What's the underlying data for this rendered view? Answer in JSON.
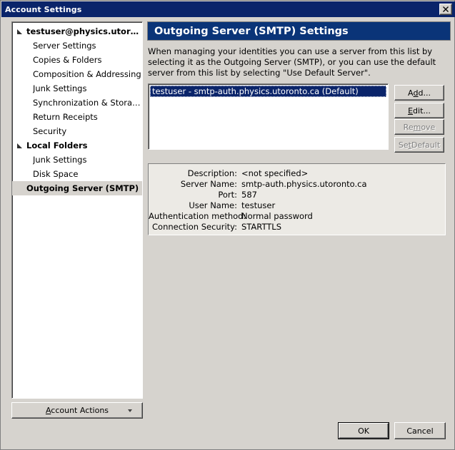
{
  "window": {
    "title": "Account Settings",
    "close_icon": "close-icon",
    "close_label": "✕"
  },
  "sidebar": {
    "items": [
      {
        "label": "testuser@physics.utoron...",
        "level": 0,
        "expanded": true,
        "selected": false
      },
      {
        "label": "Server Settings",
        "level": 1,
        "expanded": false,
        "selected": false
      },
      {
        "label": "Copies & Folders",
        "level": 1,
        "expanded": false,
        "selected": false
      },
      {
        "label": "Composition & Addressing",
        "level": 1,
        "expanded": false,
        "selected": false
      },
      {
        "label": "Junk Settings",
        "level": 1,
        "expanded": false,
        "selected": false
      },
      {
        "label": "Synchronization & Storage",
        "level": 1,
        "expanded": false,
        "selected": false
      },
      {
        "label": "Return Receipts",
        "level": 1,
        "expanded": false,
        "selected": false
      },
      {
        "label": "Security",
        "level": 1,
        "expanded": false,
        "selected": false
      },
      {
        "label": "Local Folders",
        "level": 0,
        "expanded": true,
        "selected": false
      },
      {
        "label": "Junk Settings",
        "level": 1,
        "expanded": false,
        "selected": false
      },
      {
        "label": "Disk Space",
        "level": 1,
        "expanded": false,
        "selected": false
      },
      {
        "label": "Outgoing Server (SMTP)",
        "level": 0,
        "expanded": false,
        "selected": true
      }
    ],
    "account_actions": {
      "label": "Account Actions",
      "accel": "A",
      "arrow_icon": "chevron-down-icon"
    }
  },
  "panel": {
    "header": "Outgoing Server (SMTP) Settings",
    "description": "When managing your identities you can use a server from this list by selecting it as the Outgoing Server (SMTP), or you can use the default server from this list by selecting \"Use Default Server\".",
    "server_list": {
      "items": [
        {
          "label": "testuser - smtp-auth.physics.utoronto.ca (Default)",
          "selected": true
        }
      ]
    },
    "buttons": [
      {
        "label": "Add...",
        "accel": "d",
        "enabled": true
      },
      {
        "label": "Edit...",
        "accel": "E",
        "enabled": false
      },
      {
        "label": "Remove",
        "accel": "m",
        "enabled": false
      },
      {
        "label": "Set Default",
        "accel": "t",
        "enabled": false
      }
    ],
    "details": [
      {
        "label": "Description:",
        "value": "<not specified>"
      },
      {
        "label": "Server Name:",
        "value": "smtp-auth.physics.utoronto.ca"
      },
      {
        "label": "Port:",
        "value": "587"
      },
      {
        "label": "User Name:",
        "value": "testuser"
      },
      {
        "label": "Authentication method:",
        "value": "Normal password"
      },
      {
        "label": "Connection Security:",
        "value": "STARTTLS"
      }
    ]
  },
  "footer": {
    "ok_label": "OK",
    "cancel_label": "Cancel"
  },
  "colors": {
    "titlebar": "#0a246a",
    "panel_header": "#0a3478",
    "selection": "#0a246a",
    "face": "#d6d3ce",
    "details_bg": "#eceae5"
  }
}
